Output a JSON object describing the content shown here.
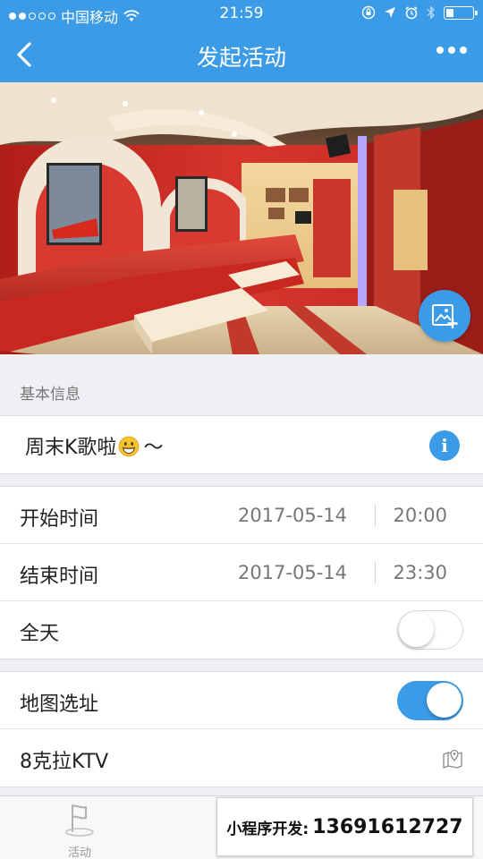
{
  "status_bar": {
    "carrier": "中国移动",
    "time": "21:59"
  },
  "nav": {
    "title": "发起活动"
  },
  "section": {
    "basic_info": "基本信息"
  },
  "event": {
    "name": "周末K歌啦",
    "name_suffix": "～"
  },
  "time_rows": [
    {
      "label": "开始时间",
      "date": "2017-05-14",
      "time": "20:00"
    },
    {
      "label": "结束时间",
      "date": "2017-05-14",
      "time": "23:30"
    }
  ],
  "all_day": {
    "label": "全天",
    "on": false
  },
  "map": {
    "label": "地图选址",
    "on": true
  },
  "location": {
    "name": "8克拉KTV"
  },
  "tabbar": {
    "tab_activity": "活动"
  },
  "watermark": {
    "label": "小程序开发:",
    "phone": "13691612727"
  },
  "colors": {
    "accent": "#3b9be6",
    "background": "#efeff4"
  }
}
